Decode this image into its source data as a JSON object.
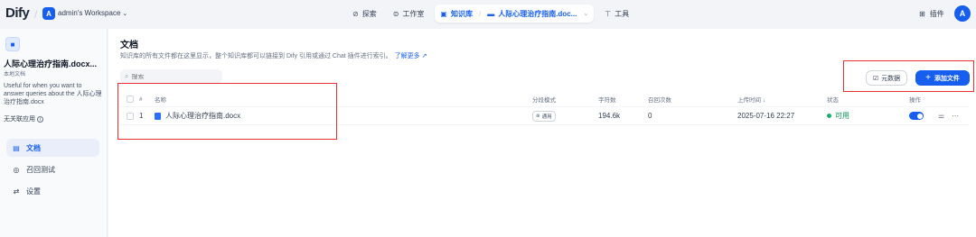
{
  "app": {
    "logo": "Dify",
    "workspace_initial": "A",
    "workspace_name": "admin's Workspace",
    "user_initial": "A"
  },
  "nav": {
    "explore": "探索",
    "studio": "工作室",
    "knowledge": "知识库",
    "current_kb": "人际心理治疗指南.doc...",
    "tools": "工具",
    "plugins": "插件"
  },
  "sidebar": {
    "kb_title": "人际心理治疗指南.docx...",
    "kb_subtitle": "本地文档",
    "kb_description": "Useful for when you want to answer queries about the 人际心理治疗指南.docx",
    "related_apps": "无关联应用",
    "menu": [
      {
        "label": "文档",
        "icon": "document-icon",
        "active": true
      },
      {
        "label": "召回测试",
        "icon": "target-icon",
        "active": false
      },
      {
        "label": "设置",
        "icon": "settings-icon",
        "active": false
      }
    ]
  },
  "main": {
    "title": "文档",
    "description": "知识库的所有文件都在这里显示，整个知识库都可以链接到 Dify 引用或通过 Chat 插件进行索引。",
    "learn_more": "了解更多",
    "search_placeholder": "搜索",
    "metadata_button": "元数据",
    "add_file_button": "添加文件"
  },
  "table": {
    "headers": {
      "index": "#",
      "name": "名称",
      "mode": "分段模式",
      "chars": "字符数",
      "recall": "召回次数",
      "uploaded": "上传时间 ↓",
      "status": "状态",
      "actions": "操作"
    },
    "rows": [
      {
        "index": "1",
        "name": "人际心理治疗指南.docx",
        "mode": "通用",
        "chars": "194.6k",
        "recall": "0",
        "uploaded": "2025-07-16 22:27",
        "status": "可用",
        "enabled": true
      }
    ]
  },
  "colors": {
    "accent": "#155eef",
    "status_ok": "#17b26a",
    "highlight": "#e8312e"
  }
}
